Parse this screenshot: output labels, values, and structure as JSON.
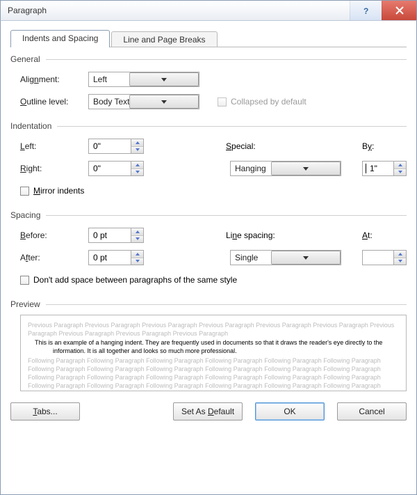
{
  "window": {
    "title": "Paragraph"
  },
  "tabs": {
    "indents": "Indents and Spacing",
    "breaks": "Line and Page Breaks"
  },
  "general": {
    "legend": "General",
    "alignment_label": "Alignment:",
    "alignment_value": "Left",
    "outline_label": "Outline level:",
    "outline_value": "Body Text",
    "collapsed_label": "Collapsed by default"
  },
  "indent": {
    "legend": "Indentation",
    "left_label": "Left:",
    "left_value": "0\"",
    "right_label": "Right:",
    "right_value": "0\"",
    "special_label": "Special:",
    "special_value": "Hanging",
    "by_label": "By:",
    "by_value": "1\"",
    "mirror_label": "Mirror indents"
  },
  "spacing": {
    "legend": "Spacing",
    "before_label": "Before:",
    "before_value": "0 pt",
    "after_label": "After:",
    "after_value": "0 pt",
    "line_label": "Line spacing:",
    "line_value": "Single",
    "at_label": "At:",
    "at_value": "",
    "nospace_label": "Don't add space between paragraphs of the same style"
  },
  "preview": {
    "legend": "Preview",
    "prev_text": "Previous Paragraph Previous Paragraph Previous Paragraph Previous Paragraph Previous Paragraph Previous Paragraph Previous Paragraph Previous Paragraph Previous Paragraph Previous Paragraph",
    "sample_text": "This is an example of a hanging indent.  They are frequently used in documents so that it draws the reader's eye directly to the information.  It is all together and looks so much more professional.",
    "follow_text": "Following Paragraph Following Paragraph Following Paragraph Following Paragraph Following Paragraph Following Paragraph Following Paragraph Following Paragraph Following Paragraph Following Paragraph Following Paragraph Following Paragraph Following Paragraph Following Paragraph Following Paragraph Following Paragraph Following Paragraph Following Paragraph Following Paragraph Following Paragraph Following Paragraph Following Paragraph Following Paragraph Following Paragraph Following Paragraph"
  },
  "buttons": {
    "tabs": "Tabs...",
    "default": "Set As Default",
    "ok": "OK",
    "cancel": "Cancel"
  }
}
